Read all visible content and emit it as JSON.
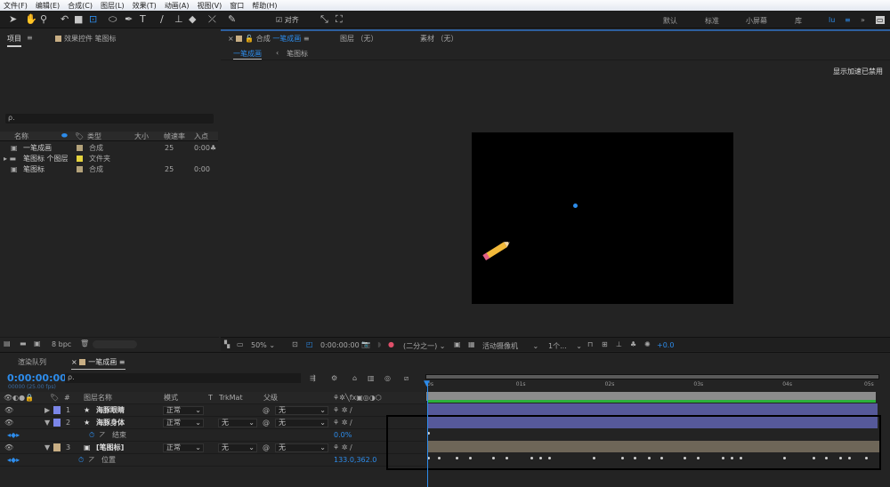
{
  "menu": [
    "文件(F)",
    "编辑(E)",
    "合成(C)",
    "图层(L)",
    "效果(T)",
    "动画(A)",
    "视图(V)",
    "窗口",
    "帮助(H)"
  ],
  "toolbar": {
    "snap_label": "对齐",
    "workspaces": [
      "默认",
      "标准",
      "小屏幕",
      "库"
    ]
  },
  "project_panel": {
    "tab": "项目",
    "effects_tab": "效果控件 笔图标",
    "search_placeholder": "ρ.",
    "columns": [
      "名称",
      "类型",
      "大小",
      "帧速率",
      "入点"
    ],
    "items": [
      {
        "name": "一笔成画",
        "type": "合成",
        "fps": "25",
        "in": "0:00",
        "color": "#b3a27a"
      },
      {
        "name": "笔图标 个图层",
        "type": "文件夹",
        "fps": "",
        "in": "",
        "color": "#e5d33d"
      },
      {
        "name": "笔图标",
        "type": "合成",
        "fps": "25",
        "in": "0:00",
        "color": "#b3a27a"
      }
    ],
    "bpc": "8 bpc"
  },
  "comp_panel": {
    "tab_prefix": "合成",
    "comp_name": "一笔成画",
    "layer_tab": "图层 （无）",
    "footage_tab": "素材 （无）",
    "breadcrumbs": [
      "一笔成画",
      "笔图标"
    ],
    "gpu_notice": "显示加速已禁用",
    "footer": {
      "zoom": "50%",
      "timecode": "0:00:00:00",
      "resolution": "(二分之一)",
      "camera": "活动摄像机",
      "views": "1个...",
      "exposure": "+0.0"
    }
  },
  "timeline": {
    "render_queue_tab": "渲染队列",
    "comp_tab": "一笔成画",
    "timecode": "0:00:00:00",
    "frame_info": "00000 (25.00 fps)",
    "columns": {
      "num": "#",
      "name": "图层名称",
      "mode": "模式",
      "t": "T",
      "trkmat": "TrkMat",
      "parent": "父级"
    },
    "ruler": [
      "0s",
      "01s",
      "02s",
      "03s",
      "04s",
      "05s"
    ],
    "layers": [
      {
        "num": "1",
        "name": "海豚眼睛",
        "mode": "正常",
        "trkmat": "",
        "parent": "无",
        "color": "#7b86e8",
        "expanded": false
      },
      {
        "num": "2",
        "name": "海豚身体",
        "mode": "正常",
        "trkmat": "无",
        "parent": "无",
        "color": "#7b86e8",
        "expanded": true,
        "property": {
          "name": "结束",
          "value": "0.0%"
        }
      },
      {
        "num": "3",
        "name": "[笔图标]",
        "mode": "正常",
        "trkmat": "无",
        "parent": "无",
        "color": "#c8ae84",
        "expanded": true,
        "property": {
          "name": "位置",
          "value": "133.0,362.0"
        }
      }
    ],
    "position_keyframes_s": [
      0,
      0.12,
      0.32,
      0.47,
      0.73,
      0.88,
      1.16,
      1.26,
      1.36,
      1.86,
      2.18,
      2.32,
      2.48,
      2.63,
      2.89,
      3.04,
      3.32,
      3.42,
      3.52,
      4.01,
      4.34,
      4.48,
      4.64,
      4.74,
      4.93
    ],
    "end_keyframes_s": [
      0
    ]
  }
}
